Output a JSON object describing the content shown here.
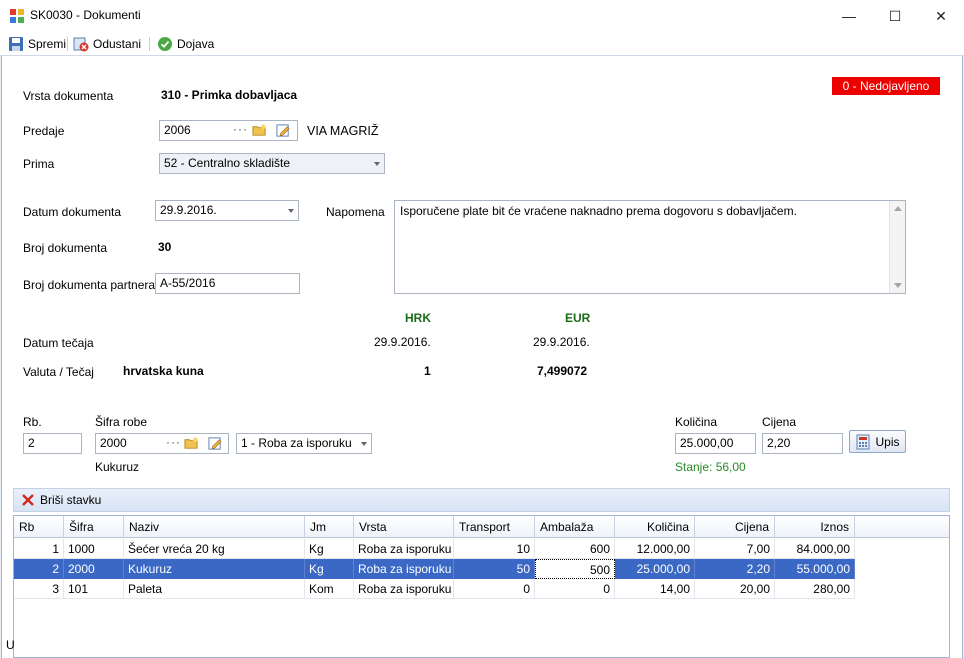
{
  "window": {
    "title": "SK0030 - Dokumenti",
    "minimize": "—",
    "maximize": "☐",
    "close": "✕"
  },
  "toolbar": {
    "save_label": "Spremi",
    "cancel_label": "Odustani",
    "report_label": "Dojava"
  },
  "status_badge": "0 - Nedojavljeno",
  "form": {
    "doc_type_label": "Vrsta dokumenta",
    "doc_type_value": "310 - Primka dobavljaca",
    "predaje_label": "Predaje",
    "predaje_code": "2006",
    "predaje_name": "VIA MAGRIŽ",
    "prima_label": "Prima",
    "prima_value": "52 - Centralno skladište",
    "date_label": "Datum dokumenta",
    "date_value": "29.9.2016.",
    "napomena_label": "Napomena",
    "napomena_value": "Isporučene plate bit će vraćene naknadno prema dogovoru s dobavljačem.",
    "doc_number_label": "Broj dokumenta",
    "doc_number_value": "30",
    "partner_number_label": "Broj dokumenta partnera",
    "partner_number_value": "A-55/2016"
  },
  "currency": {
    "hrk_header": "HRK",
    "eur_header": "EUR",
    "rate_date_label": "Datum tečaja",
    "rate_date_hrk": "29.9.2016.",
    "rate_date_eur": "29.9.2016.",
    "currency_label": "Valuta / Tečaj",
    "currency_name": "hrvatska kuna",
    "rate_hrk": "1",
    "rate_eur": "7,499072"
  },
  "item_entry": {
    "rb_label": "Rb.",
    "rb_value": "2",
    "sifra_label": "Šifra robe",
    "sifra_value": "2000",
    "vrsta_value": "1 - Roba za isporuku",
    "item_name": "Kukuruz",
    "kolicina_label": "Količina",
    "kolicina_value": "25.000,00",
    "cijena_label": "Cijena",
    "cijena_value": "2,20",
    "upis_label": "Upis",
    "stanje": "Stanje: 56,00"
  },
  "grid": {
    "delete_label": "Briši stavku",
    "columns": [
      "Rb",
      "Šifra",
      "Naziv",
      "Jm",
      "Vrsta",
      "Transport",
      "Ambalaža",
      "Količina",
      "Cijena",
      "Iznos"
    ],
    "rows": [
      [
        "1",
        "1000",
        "Šećer vreća 20 kg",
        "Kg",
        "Roba za isporuku",
        "10",
        "600",
        "12.000,00",
        "7,00",
        "84.000,00"
      ],
      [
        "2",
        "2000",
        "Kukuruz",
        "Kg",
        "Roba za isporuku",
        "50",
        "500",
        "25.000,00",
        "2,20",
        "55.000,00"
      ],
      [
        "3",
        "101",
        "Paleta",
        "Kom",
        "Roba za isporuku",
        "0",
        "0",
        "14,00",
        "20,00",
        "280,00"
      ]
    ]
  },
  "status_bar_text": "U"
}
